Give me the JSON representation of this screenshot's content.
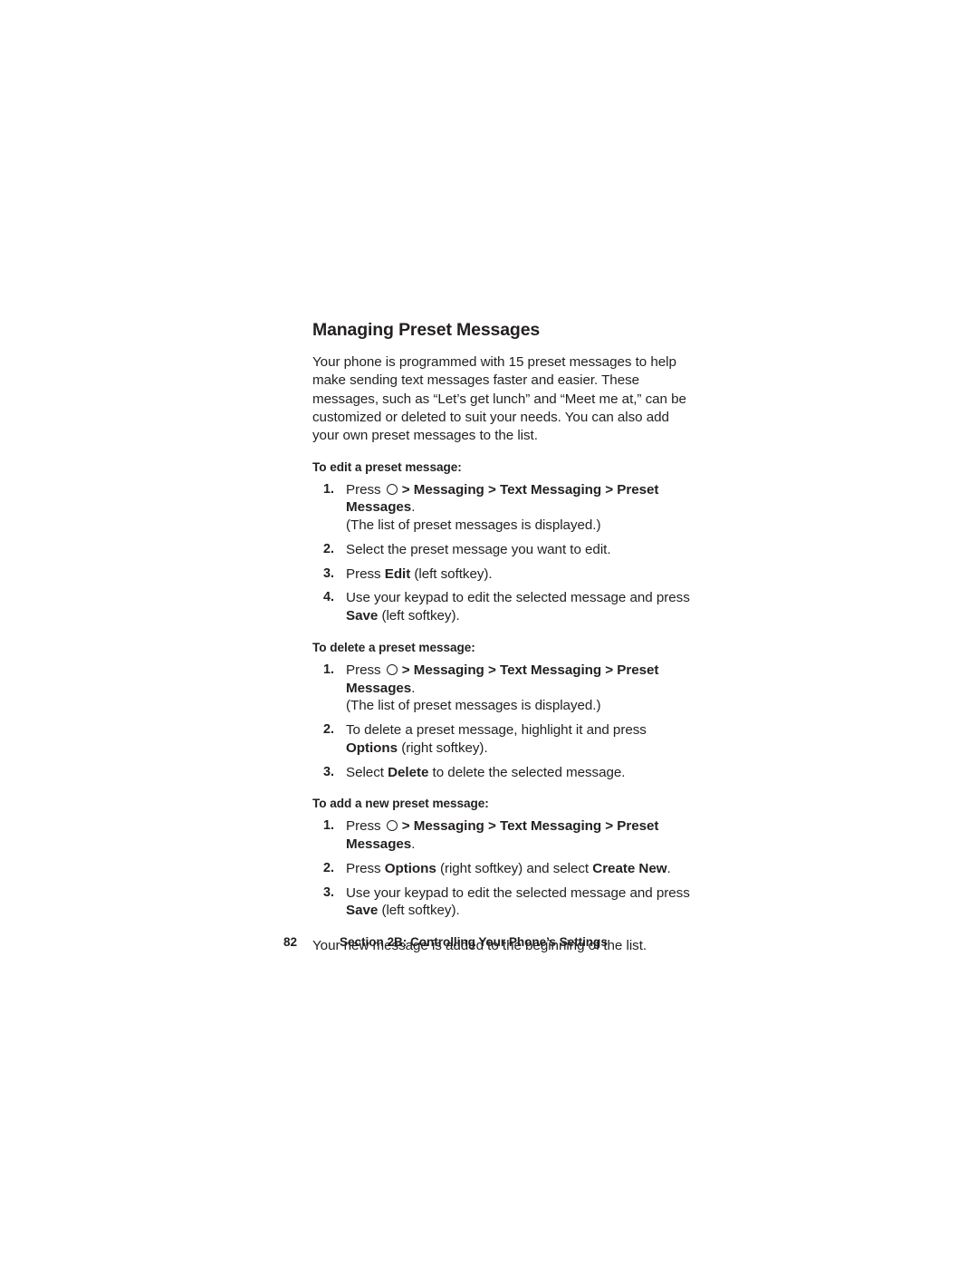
{
  "document": {
    "title": "Managing Preset Messages",
    "intro": "Your phone is programmed with 15 preset messages to help make sending text messages faster and easier. These messages, such as “Let’s get lunch” and “Meet me at,” can be customized or deleted to suit your needs. You can also add your own preset messages to the list.",
    "closing": "Your new message is added to the beginning of the list."
  },
  "icons": {
    "select_key": "circle-key-icon"
  },
  "sections": [
    {
      "heading": "To edit a preset message:",
      "steps": [
        {
          "num": "1.",
          "pre": "Press ",
          "has_key_icon": true,
          "chevron_1": ">",
          "menu_1": "Messaging",
          "chevron_2": ">",
          "menu_2": "Text Messaging",
          "chevron_3": ">",
          "menu_3": "Preset Messages",
          "post": ".",
          "sub": "(The list of preset messages is displayed.)"
        },
        {
          "num": "2.",
          "text": "Select the preset message you want to edit."
        },
        {
          "num": "3.",
          "pre": "Press ",
          "bold": "Edit",
          "post": " (left softkey)."
        },
        {
          "num": "4.",
          "pre": "Use your keypad to edit the selected message and press ",
          "bold": "Save",
          "post": " (left softkey)."
        }
      ]
    },
    {
      "heading": "To delete a preset message:",
      "steps": [
        {
          "num": "1.",
          "pre": "Press ",
          "has_key_icon": true,
          "chevron_1": ">",
          "menu_1": "Messaging",
          "chevron_2": ">",
          "menu_2": "Text Messaging",
          "chevron_3": ">",
          "menu_3": "Preset Messages",
          "post": ".",
          "sub": "(The list of preset messages is displayed.)"
        },
        {
          "num": "2.",
          "pre": "To delete a preset message, highlight it and press ",
          "bold": "Options",
          "post": " (right softkey)."
        },
        {
          "num": "3.",
          "pre": "Select ",
          "bold": "Delete",
          "post": " to delete the selected message."
        }
      ]
    },
    {
      "heading": "To add a new preset message:",
      "steps": [
        {
          "num": "1.",
          "pre": "Press ",
          "has_key_icon": true,
          "chevron_1": ">",
          "menu_1": "Messaging",
          "chevron_2": ">",
          "menu_2": "Text Messaging",
          "chevron_3": ">",
          "menu_3": "Preset Messages",
          "post": "."
        },
        {
          "num": "2.",
          "pre": "Press ",
          "bold": "Options",
          "mid": " (right softkey) and select ",
          "bold2": "Create New",
          "post": "."
        },
        {
          "num": "3.",
          "pre": "Use your keypad to edit the selected message and press ",
          "bold": "Save",
          "post": " (left softkey)."
        }
      ]
    }
  ],
  "footer": {
    "page_number": "82",
    "section_label": "Section 2B: Controlling Your Phone’s Settings"
  }
}
